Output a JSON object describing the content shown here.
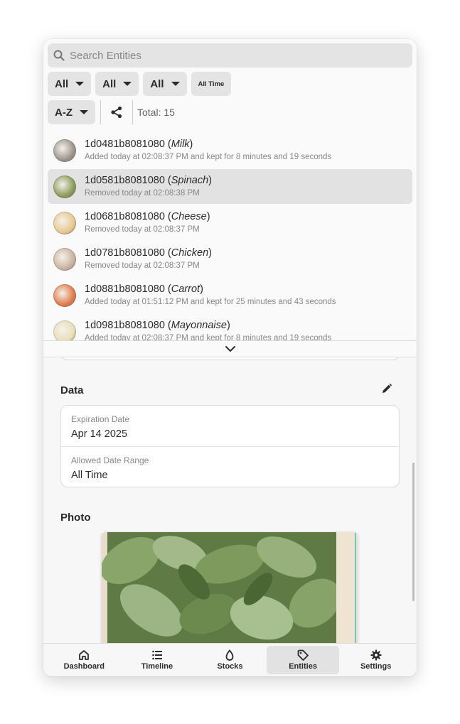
{
  "search": {
    "placeholder": "Search Entities"
  },
  "filters": [
    {
      "label": "All"
    },
    {
      "label": "All"
    },
    {
      "label": "All"
    },
    {
      "label": "All Time"
    }
  ],
  "sort": {
    "label": "A-Z"
  },
  "total": "Total: 15",
  "entities": [
    {
      "id": "1d0481b8081080",
      "name": "Milk",
      "status": "Added today at 02:08:37 PM and kept for 8 minutes and 19 seconds",
      "selected": false,
      "thumb_color": "#9a948c"
    },
    {
      "id": "1d0581b8081080",
      "name": "Spinach",
      "status": "Removed today at 02:08:38 PM",
      "selected": true,
      "thumb_color": "#8a9a5a"
    },
    {
      "id": "1d0681b8081080",
      "name": "Cheese",
      "status": "Removed today at 02:08:37 PM",
      "selected": false,
      "thumb_color": "#e6c890"
    },
    {
      "id": "1d0781b8081080",
      "name": "Chicken",
      "status": "Removed today at 02:08:37 PM",
      "selected": false,
      "thumb_color": "#c9b3a0"
    },
    {
      "id": "1d0881b8081080",
      "name": "Carrot",
      "status": "Added today at 01:51:12 PM and kept for 25 minutes and 43 seconds",
      "selected": false,
      "thumb_color": "#e07a4a"
    },
    {
      "id": "1d0981b8081080",
      "name": "Mayonnaise",
      "status": "Added today at 02:08:37 PM and kept for 8 minutes and 19 seconds",
      "selected": false,
      "thumb_color": "#e8dfb8"
    }
  ],
  "detail": {
    "data_title": "Data",
    "fields": [
      {
        "label": "Expiration Date",
        "value": "Apr 14 2025"
      },
      {
        "label": "Allowed Date Range",
        "value": "All Time"
      }
    ],
    "photo_title": "Photo"
  },
  "nav": [
    {
      "label": "Dashboard",
      "icon": "home-icon"
    },
    {
      "label": "Timeline",
      "icon": "list-icon"
    },
    {
      "label": "Stocks",
      "icon": "drop-icon"
    },
    {
      "label": "Entities",
      "icon": "tag-icon",
      "active": true
    },
    {
      "label": "Settings",
      "icon": "gear-icon"
    }
  ]
}
